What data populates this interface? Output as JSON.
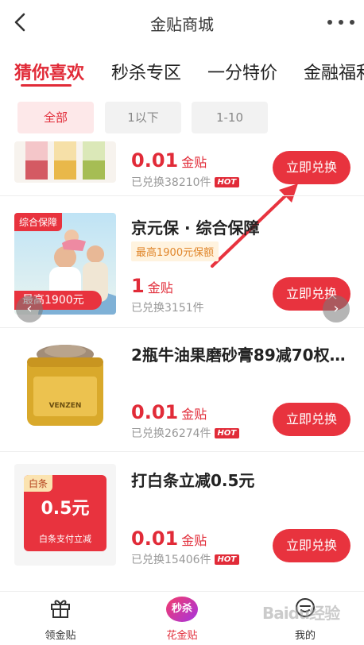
{
  "header": {
    "title": "金贴商城"
  },
  "tabs": [
    {
      "label": "猜你喜欢",
      "active": true
    },
    {
      "label": "秒杀专区"
    },
    {
      "label": "一分特价"
    },
    {
      "label": "金融福利"
    }
  ],
  "filters": [
    {
      "label": "全部",
      "active": true
    },
    {
      "label": "1以下"
    },
    {
      "label": "1-10"
    }
  ],
  "products": [
    {
      "title": "",
      "price": "0.01",
      "unit": "金贴",
      "sold": "已兑换38210件",
      "hot": "HOT",
      "button": "立即兑换"
    },
    {
      "title": "京元保 · 综合保障",
      "tag": "最高1900元保额",
      "price": "1",
      "unit": "金贴",
      "sold": "已兑换3151件",
      "button": "立即兑换",
      "thumb": {
        "badge": "综合保障",
        "caption": "最高1900元"
      }
    },
    {
      "title": "2瓶牛油果磨砂膏89减70权…",
      "price": "0.01",
      "unit": "金贴",
      "sold": "已兑换26274件",
      "hot": "HOT",
      "button": "立即兑换",
      "thumb": {
        "brand": "VENZEN"
      }
    },
    {
      "title": "打白条立减0.5元",
      "price": "0.01",
      "unit": "金贴",
      "sold": "已兑换15406件",
      "hot": "HOT",
      "button": "立即兑换",
      "thumb": {
        "tag": "白条",
        "amount": "0.5元",
        "footer": "白条支付立减"
      }
    }
  ],
  "bottom_nav": [
    {
      "label": "领金贴",
      "icon": "gift-icon"
    },
    {
      "label": "花金贴",
      "icon": "flash-sale-icon",
      "badge": "秒杀",
      "active": true
    },
    {
      "label": "我的",
      "icon": "profile-icon"
    }
  ],
  "watermark": "Baidu经验",
  "colors": {
    "accent": "#e12b38",
    "button": "#e8333e",
    "tag_bg": "#fff3df",
    "tag_text": "#e0862b"
  }
}
